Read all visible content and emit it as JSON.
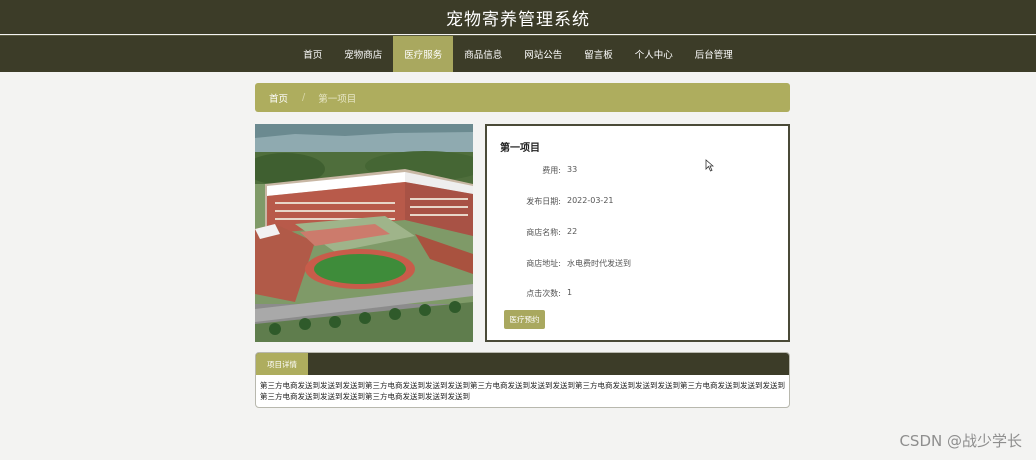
{
  "header": {
    "site_title": "宠物寄养管理系统"
  },
  "nav": {
    "items": [
      {
        "label": "首页",
        "name": "nav-home",
        "active": false
      },
      {
        "label": "宠物商店",
        "name": "nav-pet-shop",
        "active": false
      },
      {
        "label": "医疗服务",
        "name": "nav-medical-service",
        "active": true
      },
      {
        "label": "商品信息",
        "name": "nav-product-info",
        "active": false
      },
      {
        "label": "网站公告",
        "name": "nav-announcements",
        "active": false
      },
      {
        "label": "留言板",
        "name": "nav-message-board",
        "active": false
      },
      {
        "label": "个人中心",
        "name": "nav-personal-center",
        "active": false
      },
      {
        "label": "后台管理",
        "name": "nav-admin",
        "active": false
      }
    ]
  },
  "breadcrumb": {
    "home": "首页",
    "separator": "/",
    "current": "第一项目"
  },
  "detail": {
    "title": "第一项目",
    "fields": [
      {
        "label": "费用:",
        "value": "33"
      },
      {
        "label": "发布日期:",
        "value": "2022-03-21"
      },
      {
        "label": "商店名称:",
        "value": "22"
      },
      {
        "label": "商店地址:",
        "value": "水电费时代发送到"
      },
      {
        "label": "点击次数:",
        "value": "1"
      }
    ],
    "book_button": "医疗预约"
  },
  "project_details": {
    "tab_label": "项目详情",
    "text": "第三方电商发送到发送到发送到第三方电商发送到发送到发送到第三方电商发送到发送到发送到第三方电商发送到发送到发送到第三方电商发送到发送到发送到第三方电商发送到发送到发送到第三方电商发送到发送到发送到"
  },
  "watermark": "CSDN @战少学长",
  "colors": {
    "dark": "#3c3c28",
    "accent": "#a9a85f",
    "page_bg": "#f3f3f2"
  }
}
